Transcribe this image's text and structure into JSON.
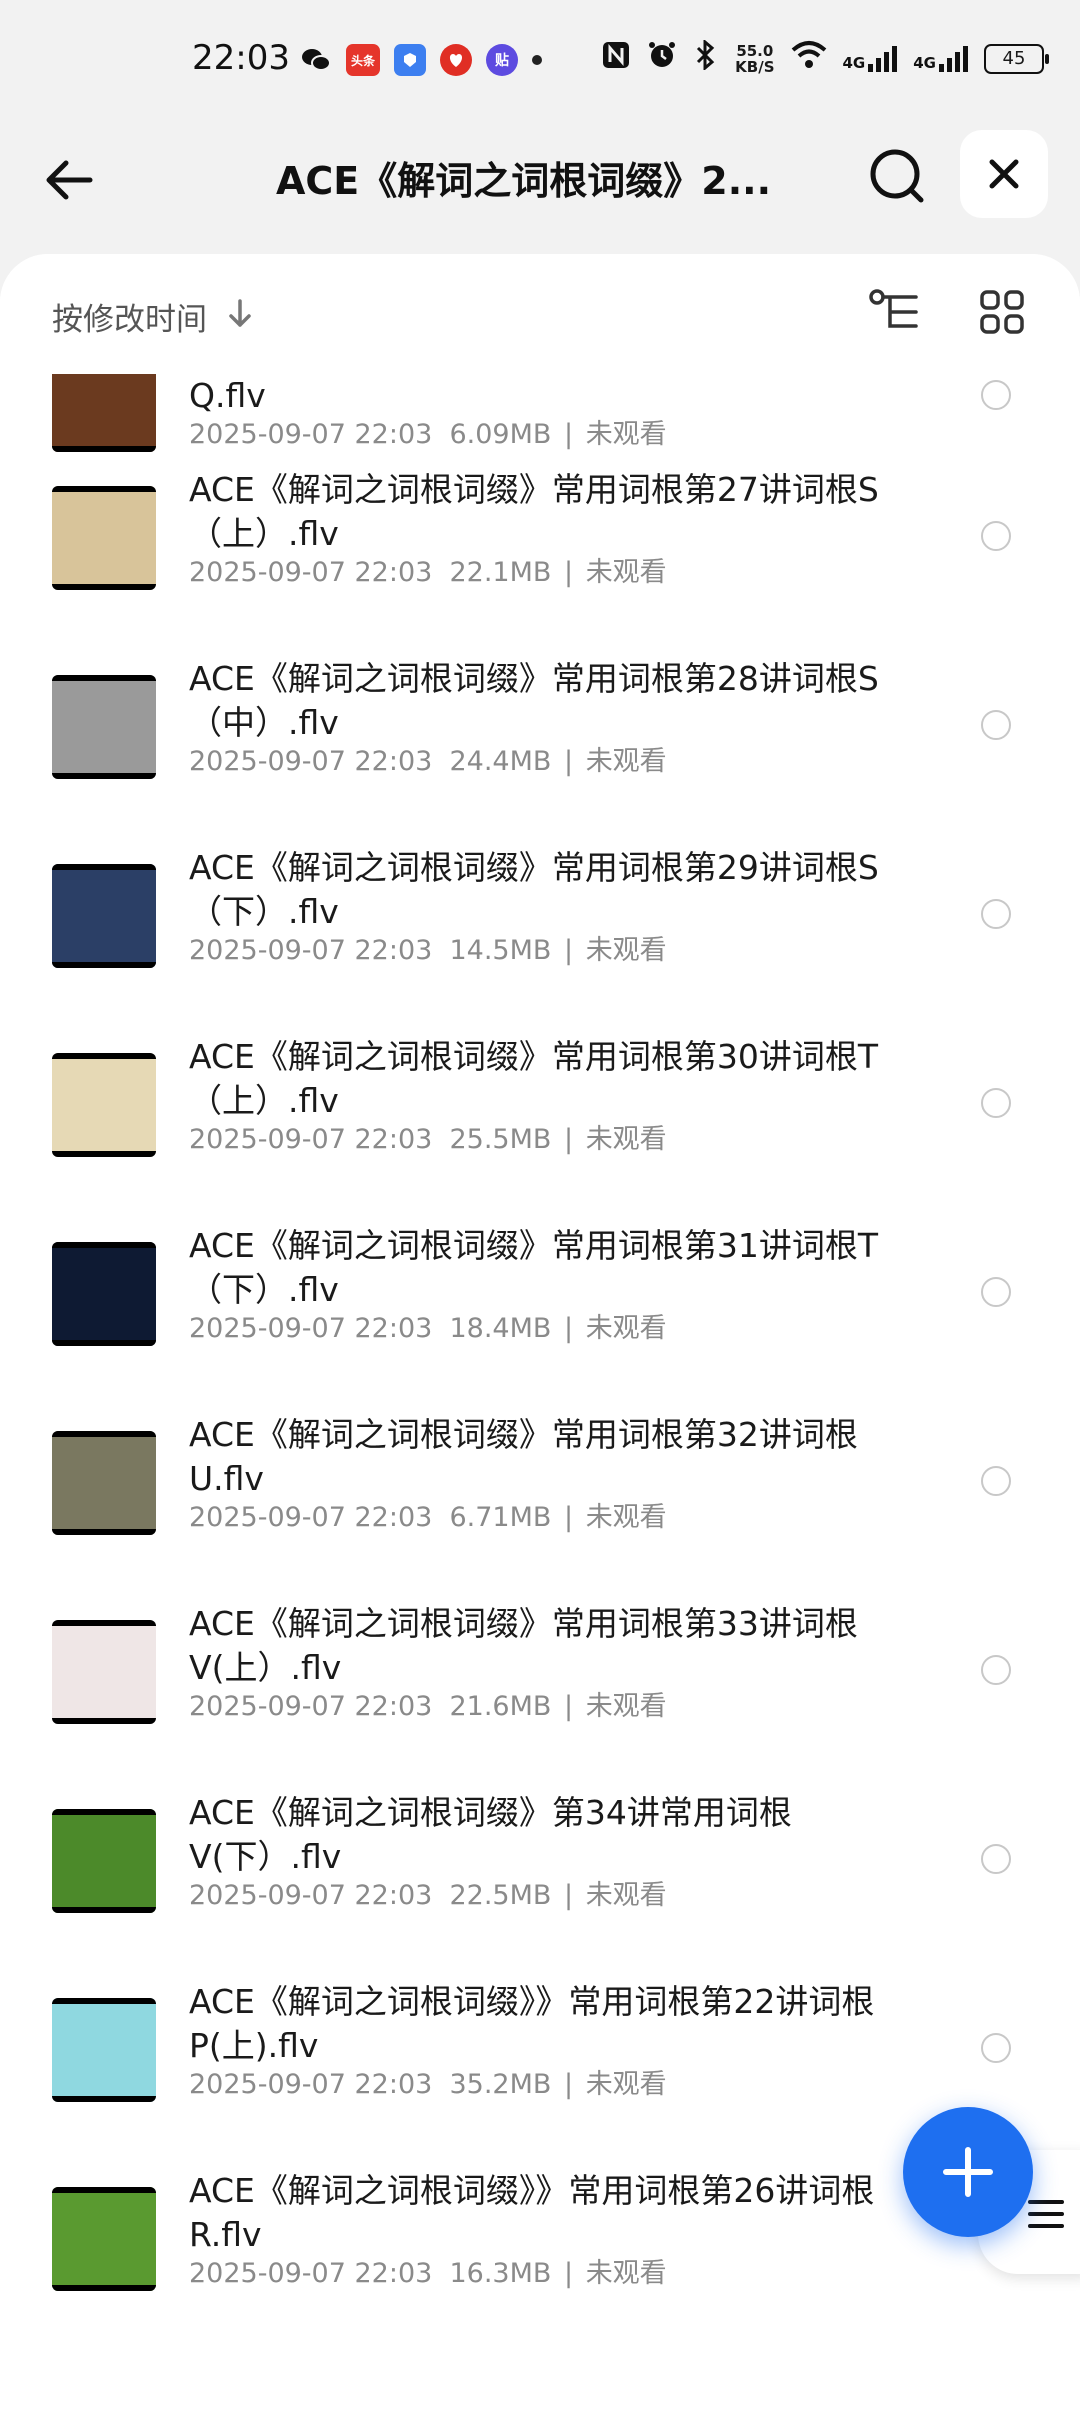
{
  "status_bar": {
    "time": "22:03",
    "toutiao_label": "头条",
    "tieba_label": "贴",
    "net_speed_value": "55.0",
    "net_speed_unit": "KB/S",
    "signal1_label": "4G",
    "signal2_label": "4G",
    "battery": "45"
  },
  "header": {
    "title": "ACE《解词之词根词缀》2..."
  },
  "sort_bar": {
    "label": "按修改时间"
  },
  "files": [
    {
      "name": "Q.flv",
      "date": "2025-09-07 22:03",
      "size": "6.09MB",
      "status": "未观看",
      "thumb_color": "#6b3a1f",
      "partial": true
    },
    {
      "name": "ACE《解词之词根词缀》常用词根第27讲词根S（上）.flv",
      "date": "2025-09-07 22:03",
      "size": "22.1MB",
      "status": "未观看",
      "thumb_color": "#d8c49a"
    },
    {
      "name": "ACE《解词之词根词缀》常用词根第28讲词根S（中）.flv",
      "date": "2025-09-07 22:03",
      "size": "24.4MB",
      "status": "未观看",
      "thumb_color": "#9a9a9a"
    },
    {
      "name": "ACE《解词之词根词缀》常用词根第29讲词根S（下）.flv",
      "date": "2025-09-07 22:03",
      "size": "14.5MB",
      "status": "未观看",
      "thumb_color": "#2b3f66"
    },
    {
      "name": "ACE《解词之词根词缀》常用词根第30讲词根T（上）.flv",
      "date": "2025-09-07 22:03",
      "size": "25.5MB",
      "status": "未观看",
      "thumb_color": "#e6d9b5"
    },
    {
      "name": "ACE《解词之词根词缀》常用词根第31讲词根T（下）.flv",
      "date": "2025-09-07 22:03",
      "size": "18.4MB",
      "status": "未观看",
      "thumb_color": "#0e1a33"
    },
    {
      "name": "ACE《解词之词根词缀》常用词根第32讲词根U.flv",
      "date": "2025-09-07 22:03",
      "size": "6.71MB",
      "status": "未观看",
      "thumb_color": "#7a7860"
    },
    {
      "name": "ACE《解词之词根词缀》常用词根第33讲词根V(上）.flv",
      "date": "2025-09-07 22:03",
      "size": "21.6MB",
      "status": "未观看",
      "thumb_color": "#efe6e6"
    },
    {
      "name": "ACE《解词之词根词缀》第34讲常用词根V(下）.flv",
      "date": "2025-09-07 22:03",
      "size": "22.5MB",
      "status": "未观看",
      "thumb_color": "#4c8a2a"
    },
    {
      "name": "ACE《解词之词根词缀》》常用词根第22讲词根P(上).flv",
      "date": "2025-09-07 22:03",
      "size": "35.2MB",
      "status": "未观看",
      "thumb_color": "#8fd8e0"
    },
    {
      "name": "ACE《解词之词根词缀》》常用词根第26讲词根R.flv",
      "date": "2025-09-07 22:03",
      "size": "16.3MB",
      "status": "未观看",
      "thumb_color": "#5a9a30"
    }
  ],
  "colors": {
    "accent": "#1e6ff0",
    "meta_text": "#8a8a8a"
  }
}
